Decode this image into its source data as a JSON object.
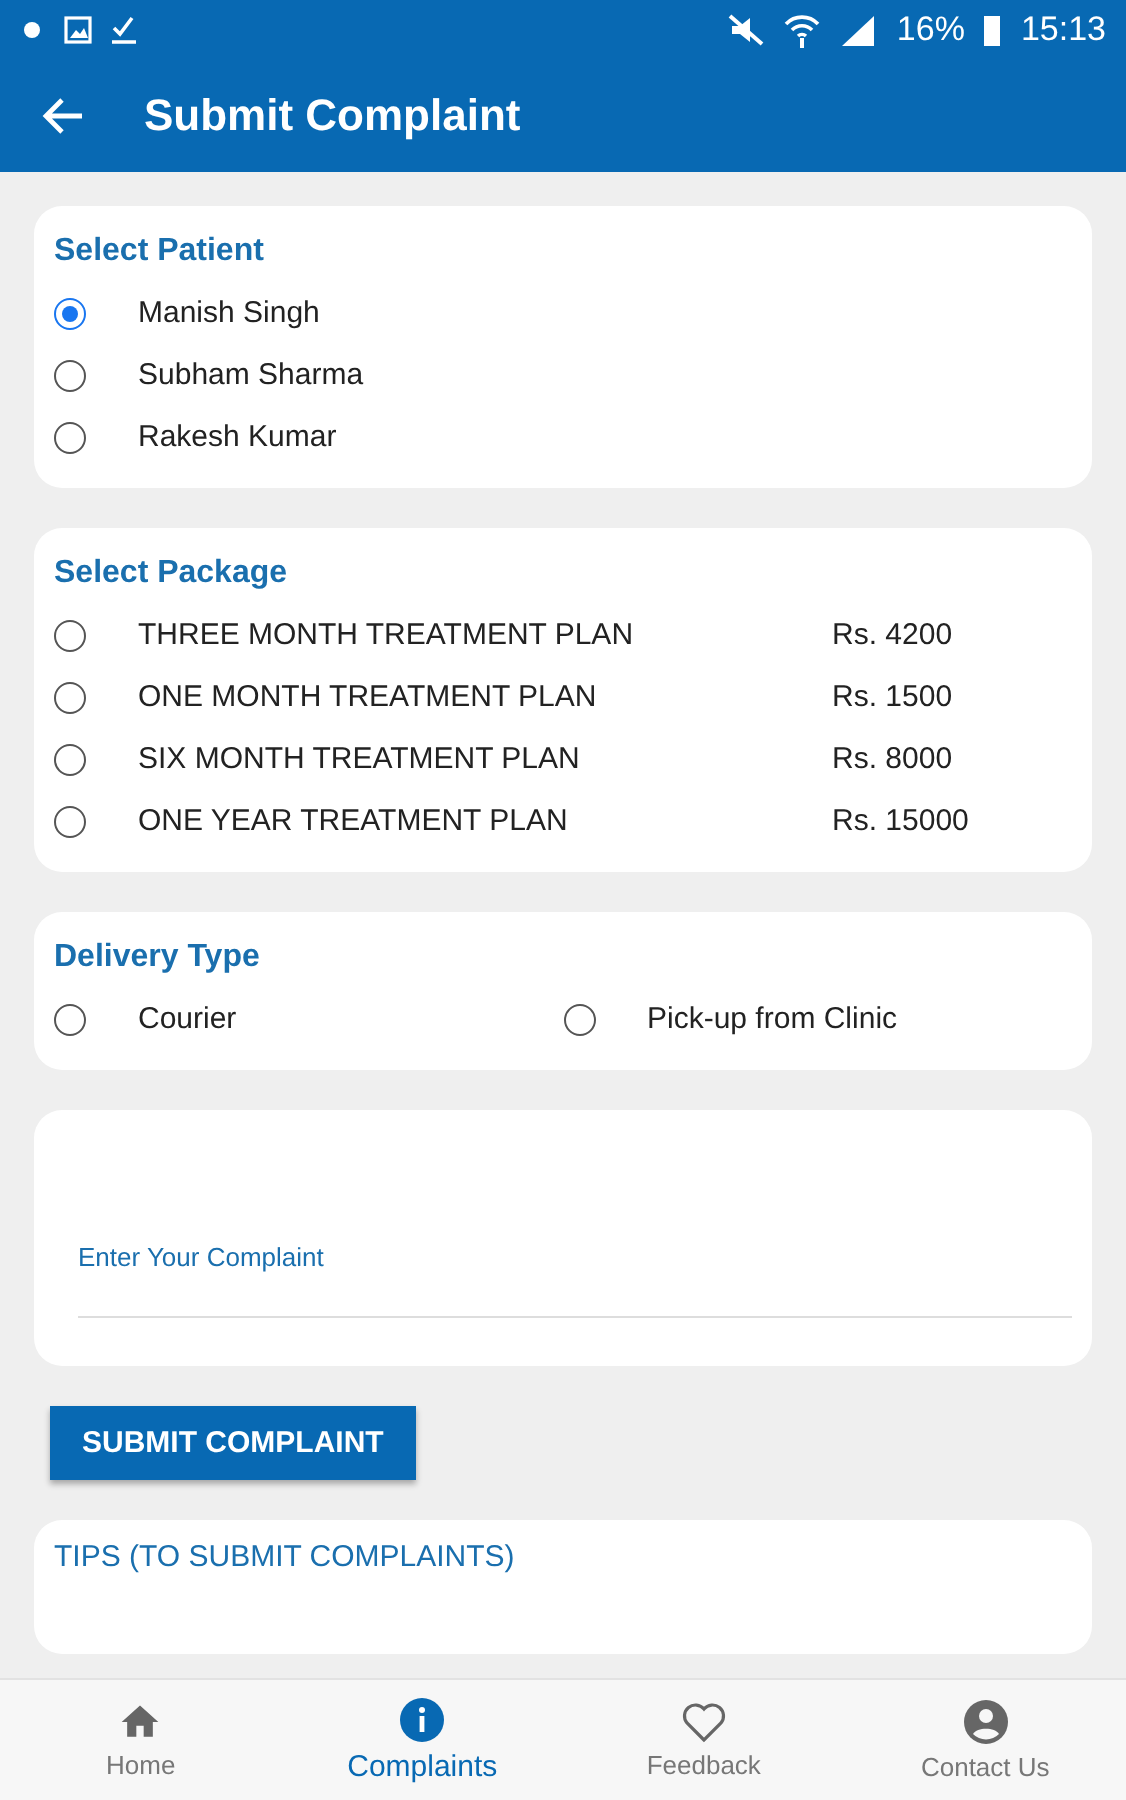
{
  "status_bar": {
    "battery": "16%",
    "time": "15:13"
  },
  "app_bar": {
    "title": "Submit Complaint"
  },
  "patient": {
    "title": "Select Patient",
    "options": [
      {
        "label": "Manish Singh",
        "selected": true
      },
      {
        "label": "Subham Sharma",
        "selected": false
      },
      {
        "label": "Rakesh Kumar",
        "selected": false
      }
    ]
  },
  "package": {
    "title": "Select Package",
    "options": [
      {
        "label": "THREE MONTH TREATMENT PLAN",
        "price": "Rs. 4200",
        "selected": false
      },
      {
        "label": "ONE MONTH TREATMENT PLAN",
        "price": "Rs. 1500",
        "selected": false
      },
      {
        "label": "SIX MONTH TREATMENT PLAN",
        "price": "Rs. 8000",
        "selected": false
      },
      {
        "label": "ONE YEAR TREATMENT PLAN",
        "price": "Rs. 15000",
        "selected": false
      }
    ]
  },
  "delivery": {
    "title": "Delivery Type",
    "options": [
      {
        "label": "Courier",
        "selected": false
      },
      {
        "label": "Pick-up from Clinic",
        "selected": false
      }
    ]
  },
  "complaint": {
    "placeholder": "Enter Your Complaint"
  },
  "submit_button": "SUBMIT COMPLAINT",
  "tips": {
    "title": "TIPS (TO SUBMIT COMPLAINTS)"
  },
  "bottom_nav": [
    {
      "kind": "home",
      "label": "Home",
      "selected": false
    },
    {
      "kind": "info",
      "label": "Complaints",
      "selected": true
    },
    {
      "kind": "heart",
      "label": "Feedback",
      "selected": false
    },
    {
      "kind": "person",
      "label": "Contact Us",
      "selected": false
    }
  ]
}
